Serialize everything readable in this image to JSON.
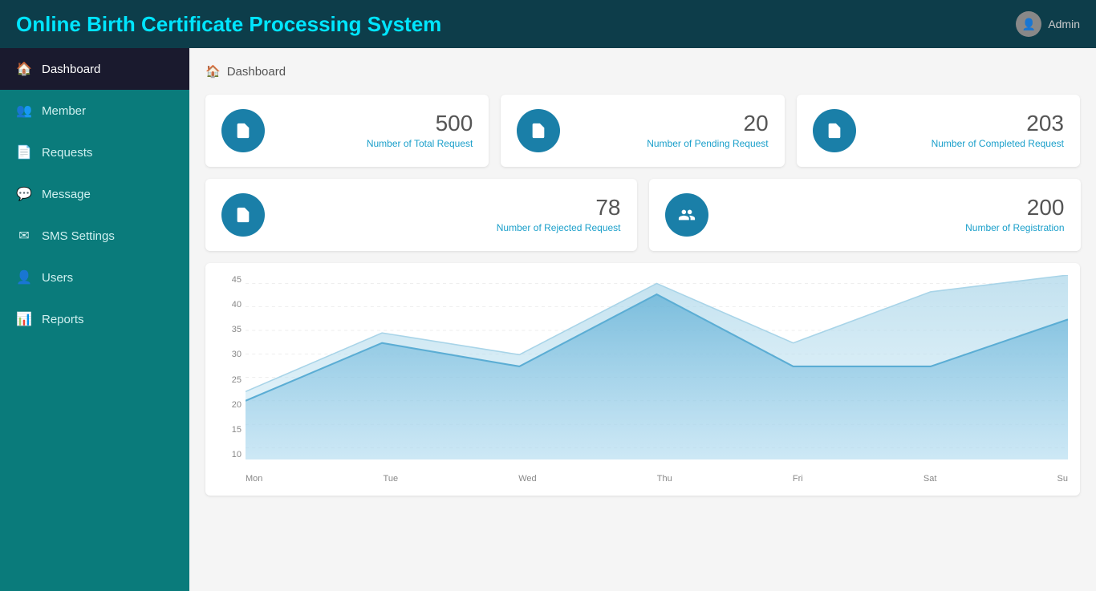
{
  "header": {
    "title": "Online Birth Certificate Processing System",
    "admin_label": "Admin"
  },
  "sidebar": {
    "items": [
      {
        "id": "dashboard",
        "label": "Dashboard",
        "icon": "🏠",
        "active": true
      },
      {
        "id": "member",
        "label": "Member",
        "icon": "👥",
        "active": false
      },
      {
        "id": "requests",
        "label": "Requests",
        "icon": "📄",
        "active": false
      },
      {
        "id": "message",
        "label": "Message",
        "icon": "💬",
        "active": false
      },
      {
        "id": "sms-settings",
        "label": "SMS Settings",
        "icon": "✉",
        "active": false
      },
      {
        "id": "users",
        "label": "Users",
        "icon": "👤",
        "active": false
      },
      {
        "id": "reports",
        "label": "Reports",
        "icon": "📊",
        "active": false
      }
    ]
  },
  "breadcrumb": {
    "icon": "🏠",
    "label": "Dashboard"
  },
  "stats": {
    "row1": [
      {
        "id": "total",
        "number": "500",
        "label": "Number of Total Request",
        "icon": "📄"
      },
      {
        "id": "pending",
        "number": "20",
        "label": "Number of Pending Request",
        "icon": "📄"
      },
      {
        "id": "completed",
        "number": "203",
        "label": "Number of Completed Request",
        "icon": "📄"
      }
    ],
    "row2": [
      {
        "id": "rejected",
        "number": "78",
        "label": "Number of Rejected Request",
        "icon": "📄"
      },
      {
        "id": "registration",
        "number": "200",
        "label": "Number of Registration",
        "icon": "👤"
      }
    ]
  },
  "chart": {
    "y_labels": [
      "10",
      "15",
      "20",
      "25",
      "30",
      "35",
      "40",
      "45"
    ],
    "x_labels": [
      "Mon",
      "Tue",
      "Wed",
      "Thu",
      "Fri",
      "Sat",
      "Su"
    ]
  },
  "colors": {
    "sidebar_bg": "#0a7b7b",
    "header_bg": "#0d3d4a",
    "accent": "#1a7fa8",
    "accent_text": "#1a9fca"
  }
}
